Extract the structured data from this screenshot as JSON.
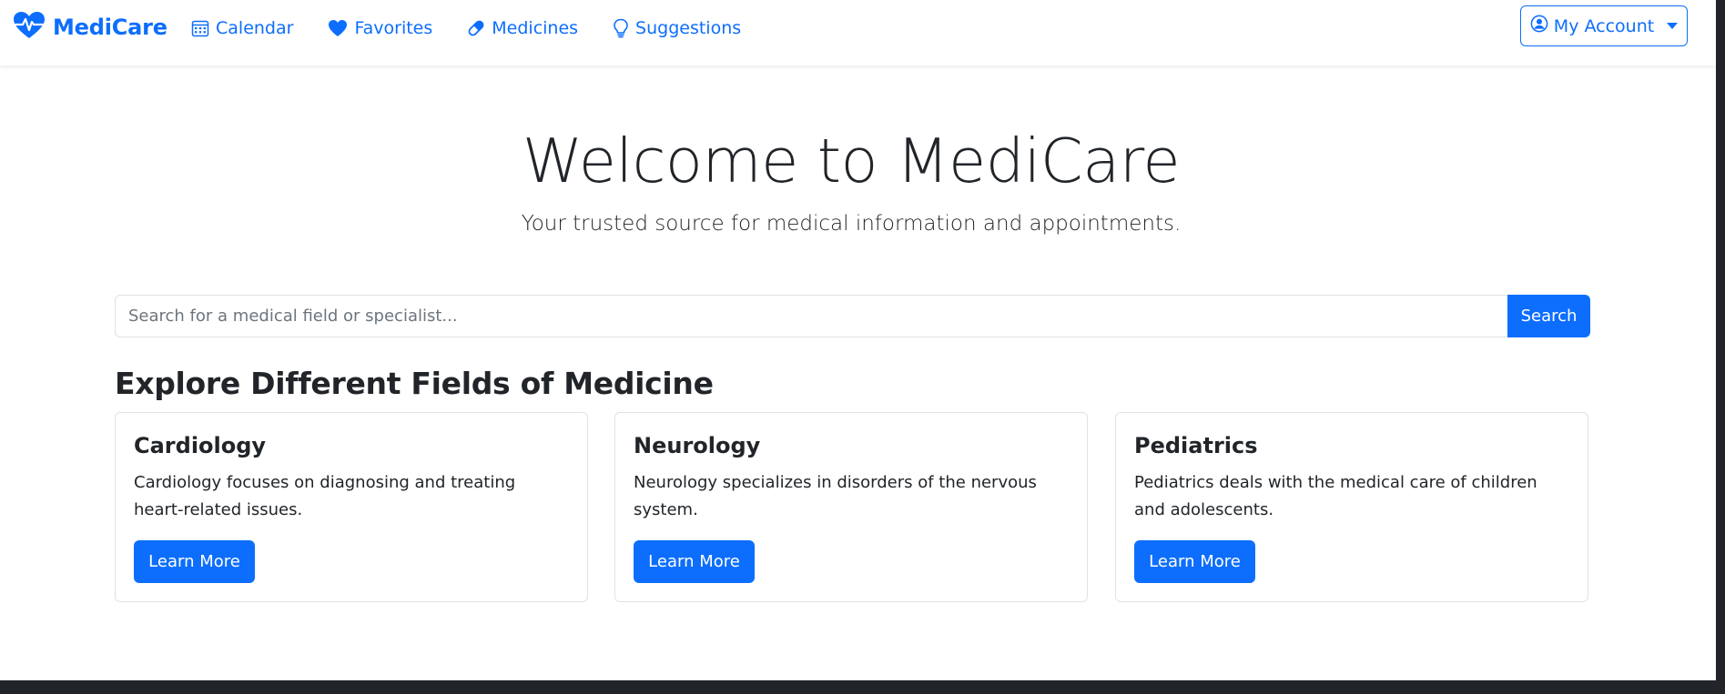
{
  "colors": {
    "primary": "#0d6efd",
    "text": "#212529",
    "muted": "#6c757d",
    "border": "#dee2e6",
    "dark_frame": "#212529"
  },
  "navbar": {
    "brand": {
      "icon": "heartbeat-icon",
      "label": "MediCare"
    },
    "links": [
      {
        "icon": "calendar-icon",
        "label": "Calendar"
      },
      {
        "icon": "heart-icon",
        "label": "Favorites"
      },
      {
        "icon": "capsule-icon",
        "label": "Medicines"
      },
      {
        "icon": "lightbulb-icon",
        "label": "Suggestions"
      }
    ],
    "account": {
      "icon": "user-circle-icon",
      "label": "My Account",
      "caret_icon": "caret-down-icon"
    }
  },
  "hero": {
    "title": "Welcome to MediCare",
    "subtitle": "Your trusted source for medical information and appointments."
  },
  "search": {
    "placeholder": "Search for a medical field or specialist...",
    "value": "",
    "button_label": "Search"
  },
  "fields_section": {
    "heading": "Explore Different Fields of Medicine",
    "cards": [
      {
        "title": "Cardiology",
        "text": "Cardiology focuses on diagnosing and treating heart-related issues.",
        "button_label": "Learn More"
      },
      {
        "title": "Neurology",
        "text": "Neurology specializes in disorders of the nervous system.",
        "button_label": "Learn More"
      },
      {
        "title": "Pediatrics",
        "text": "Pediatrics deals with the medical care of children and adolescents.",
        "button_label": "Learn More"
      }
    ]
  }
}
